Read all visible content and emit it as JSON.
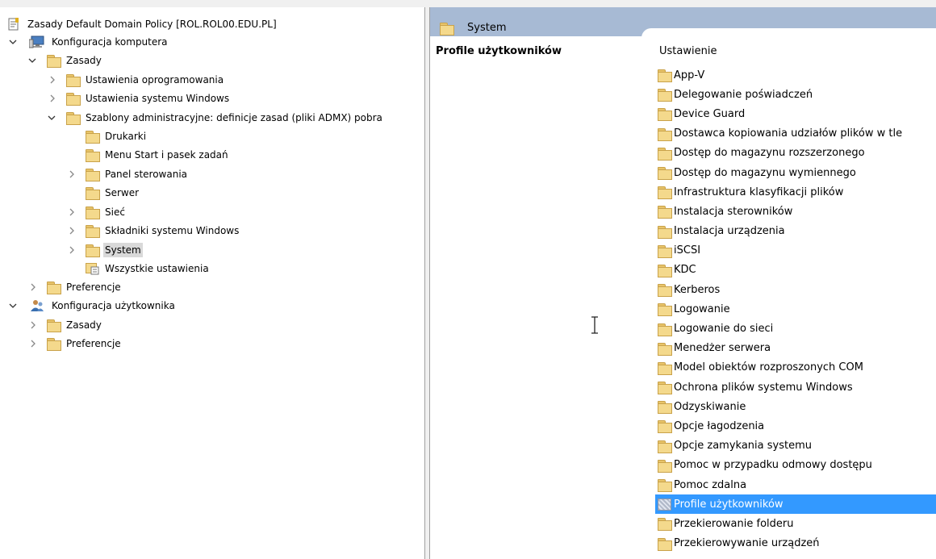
{
  "tree": {
    "root_label": "Zasady Default Domain Policy [ROL.ROL00.EDU.PL]",
    "nodes": [
      {
        "label": "Konfiguracja komputera",
        "icon": "computer-icon"
      },
      {
        "label": "Zasady",
        "icon": "folder-icon"
      },
      {
        "label": "Ustawienia oprogramowania",
        "icon": "folder-icon"
      },
      {
        "label": "Ustawienia systemu Windows",
        "icon": "folder-icon"
      },
      {
        "label": "Szablony administracyjne: definicje zasad (pliki ADMX) pobra",
        "icon": "folder-icon"
      },
      {
        "label": "Drukarki",
        "icon": "folder-icon"
      },
      {
        "label": "Menu Start i pasek zadań",
        "icon": "folder-icon"
      },
      {
        "label": "Panel sterowania",
        "icon": "folder-icon"
      },
      {
        "label": "Serwer",
        "icon": "folder-icon"
      },
      {
        "label": "Sieć",
        "icon": "folder-icon"
      },
      {
        "label": "Składniki systemu Windows",
        "icon": "folder-icon"
      },
      {
        "label": "System",
        "icon": "folder-icon",
        "selected": true
      },
      {
        "label": "Wszystkie ustawienia",
        "icon": "settings-list-icon"
      },
      {
        "label": "Preferencje",
        "icon": "folder-icon"
      },
      {
        "label": "Konfiguracja użytkownika",
        "icon": "users-icon"
      },
      {
        "label": "Zasady",
        "icon": "folder-icon"
      },
      {
        "label": "Preferencje",
        "icon": "folder-icon"
      }
    ]
  },
  "header": {
    "title": "System",
    "description_title": "Profile użytkowników",
    "column": "Ustawienie"
  },
  "items": [
    "App-V",
    "Delegowanie poświadczeń",
    "Device Guard",
    "Dostawca kopiowania udziałów plików w tle",
    "Dostęp do magazynu rozszerzonego",
    "Dostęp do magazynu wymiennego",
    "Infrastruktura klasyfikacji plików",
    "Instalacja sterowników",
    "Instalacja urządzenia",
    "iSCSI",
    "KDC",
    "Kerberos",
    "Logowanie",
    "Logowanie do sieci",
    "Menedżer serwera",
    "Model obiektów rozproszonych COM",
    "Ochrona plików systemu Windows",
    "Odzyskiwanie",
    "Opcje łagodzenia",
    "Opcje zamykania systemu",
    "Pomoc w przypadku odmowy dostępu",
    "Pomoc zdalna",
    "Profile użytkowników",
    "Przekierowanie folderu",
    "Przekierowywanie urządzeń"
  ],
  "selected_item": "Profile użytkowników",
  "colors": {
    "header_bg": "#a7bad4",
    "selection_bg": "#3399ff",
    "tree_selection_bg": "#d9d9d9",
    "folder": "#f4d98c"
  }
}
